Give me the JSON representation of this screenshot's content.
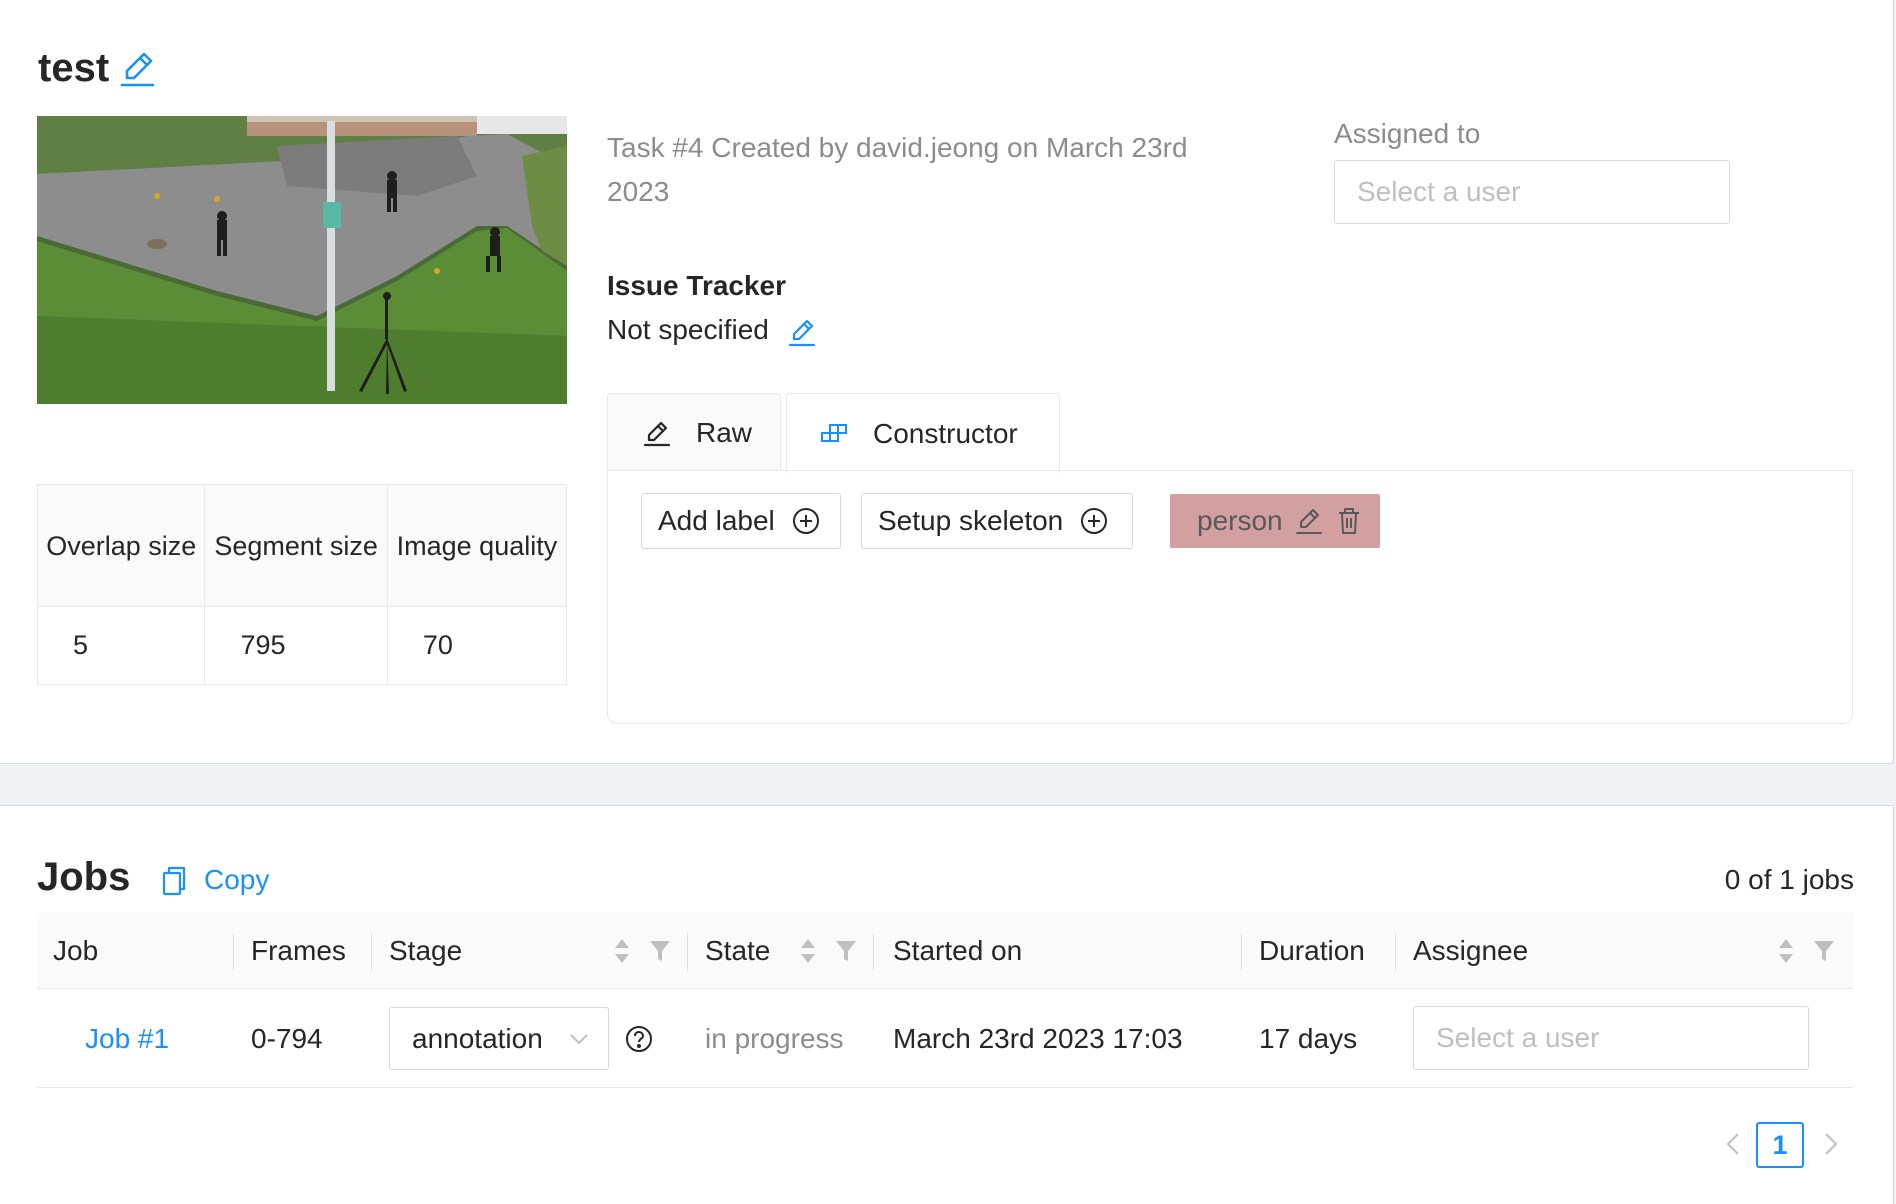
{
  "task": {
    "title": "test",
    "meta": "Task #4 Created by david.jeong on March 23rd 2023",
    "assigned_label": "Assigned to",
    "assignee_placeholder": "Select a user",
    "issue_tracker_title": "Issue Tracker",
    "issue_tracker_value": "Not specified",
    "params": {
      "headers": [
        "Overlap size",
        "Segment size",
        "Image quality"
      ],
      "values": [
        "5",
        "795",
        "70"
      ]
    }
  },
  "labels_editor": {
    "tabs": [
      {
        "label": "Raw",
        "icon": "edit-icon"
      },
      {
        "label": "Constructor",
        "icon": "build-icon"
      }
    ],
    "active_tab": "Constructor",
    "add_label": "Add label",
    "setup_skeleton": "Setup skeleton",
    "labels": [
      {
        "name": "person",
        "color": "#d2a0a0"
      }
    ]
  },
  "jobs": {
    "title": "Jobs",
    "copy": "Copy",
    "count": "0 of 1 jobs",
    "columns": [
      "Job",
      "Frames",
      "Stage",
      "State",
      "Started on",
      "Duration",
      "Assignee"
    ],
    "rows": [
      {
        "job": "Job #1",
        "frames": "0-794",
        "stage": "annotation",
        "state": "in progress",
        "started_on": "March 23rd 2023 17:03",
        "duration": "17 days",
        "assignee_placeholder": "Select a user"
      }
    ],
    "pagination": {
      "current": "1"
    }
  },
  "colors": {
    "accent": "#1890ff",
    "label_person": "#d2a0a0"
  }
}
